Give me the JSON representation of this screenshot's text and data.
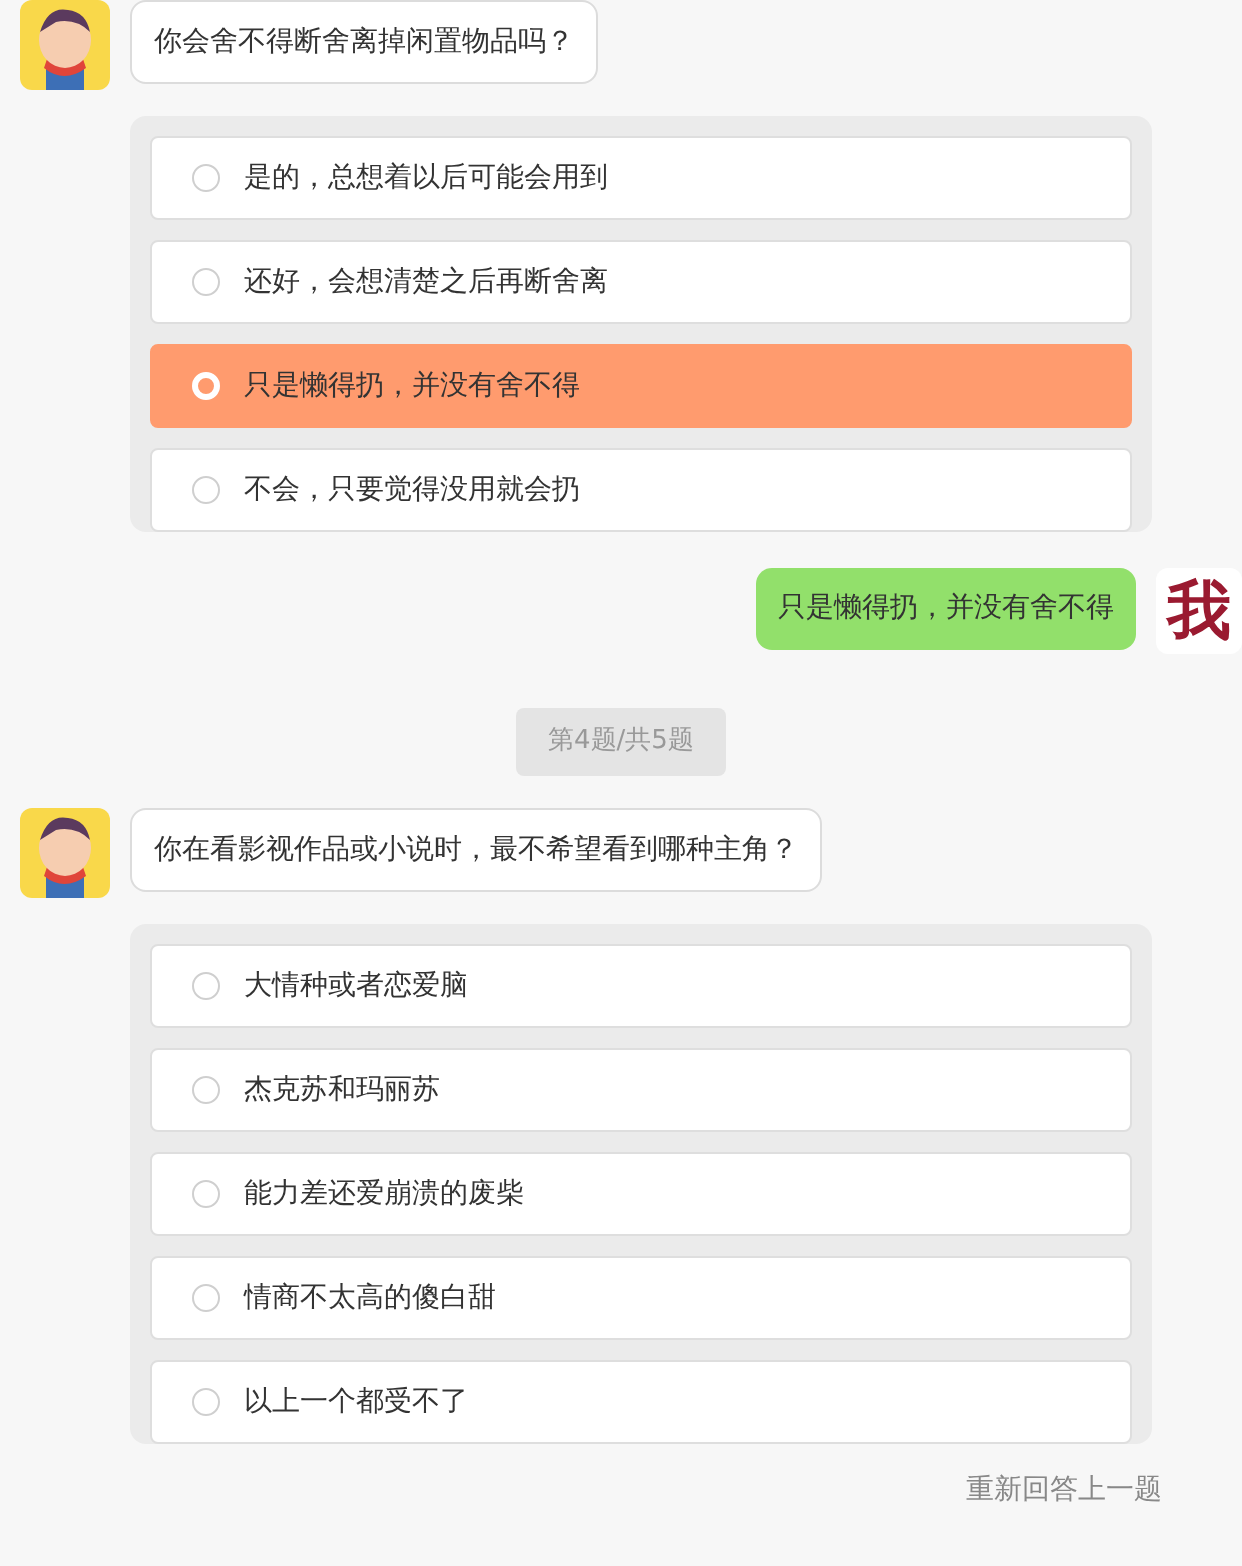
{
  "messages": [
    {
      "kind": "question",
      "text": "你会舍不得断舍离掉闲置物品吗？"
    },
    {
      "kind": "options",
      "options": [
        {
          "label": "是的，总想着以后可能会用到",
          "selected": false
        },
        {
          "label": "还好，会想清楚之后再断舍离",
          "selected": false
        },
        {
          "label": "只是懒得扔，并没有舍不得",
          "selected": true
        },
        {
          "label": "不会，只要觉得没用就会扔",
          "selected": false
        }
      ]
    },
    {
      "kind": "answer",
      "text": "只是懒得扔，并没有舍不得",
      "avatar": "我"
    },
    {
      "kind": "counter",
      "text": "第4题/共5题"
    },
    {
      "kind": "question",
      "text": "你在看影视作品或小说时，最不希望看到哪种主角？"
    },
    {
      "kind": "options",
      "options": [
        {
          "label": "大情种或者恋爱脑",
          "selected": false
        },
        {
          "label": "杰克苏和玛丽苏",
          "selected": false
        },
        {
          "label": "能力差还爱崩溃的废柴",
          "selected": false
        },
        {
          "label": "情商不太高的傻白甜",
          "selected": false
        },
        {
          "label": "以上一个都受不了",
          "selected": false
        }
      ]
    }
  ],
  "retry_link": "重新回答上一题"
}
